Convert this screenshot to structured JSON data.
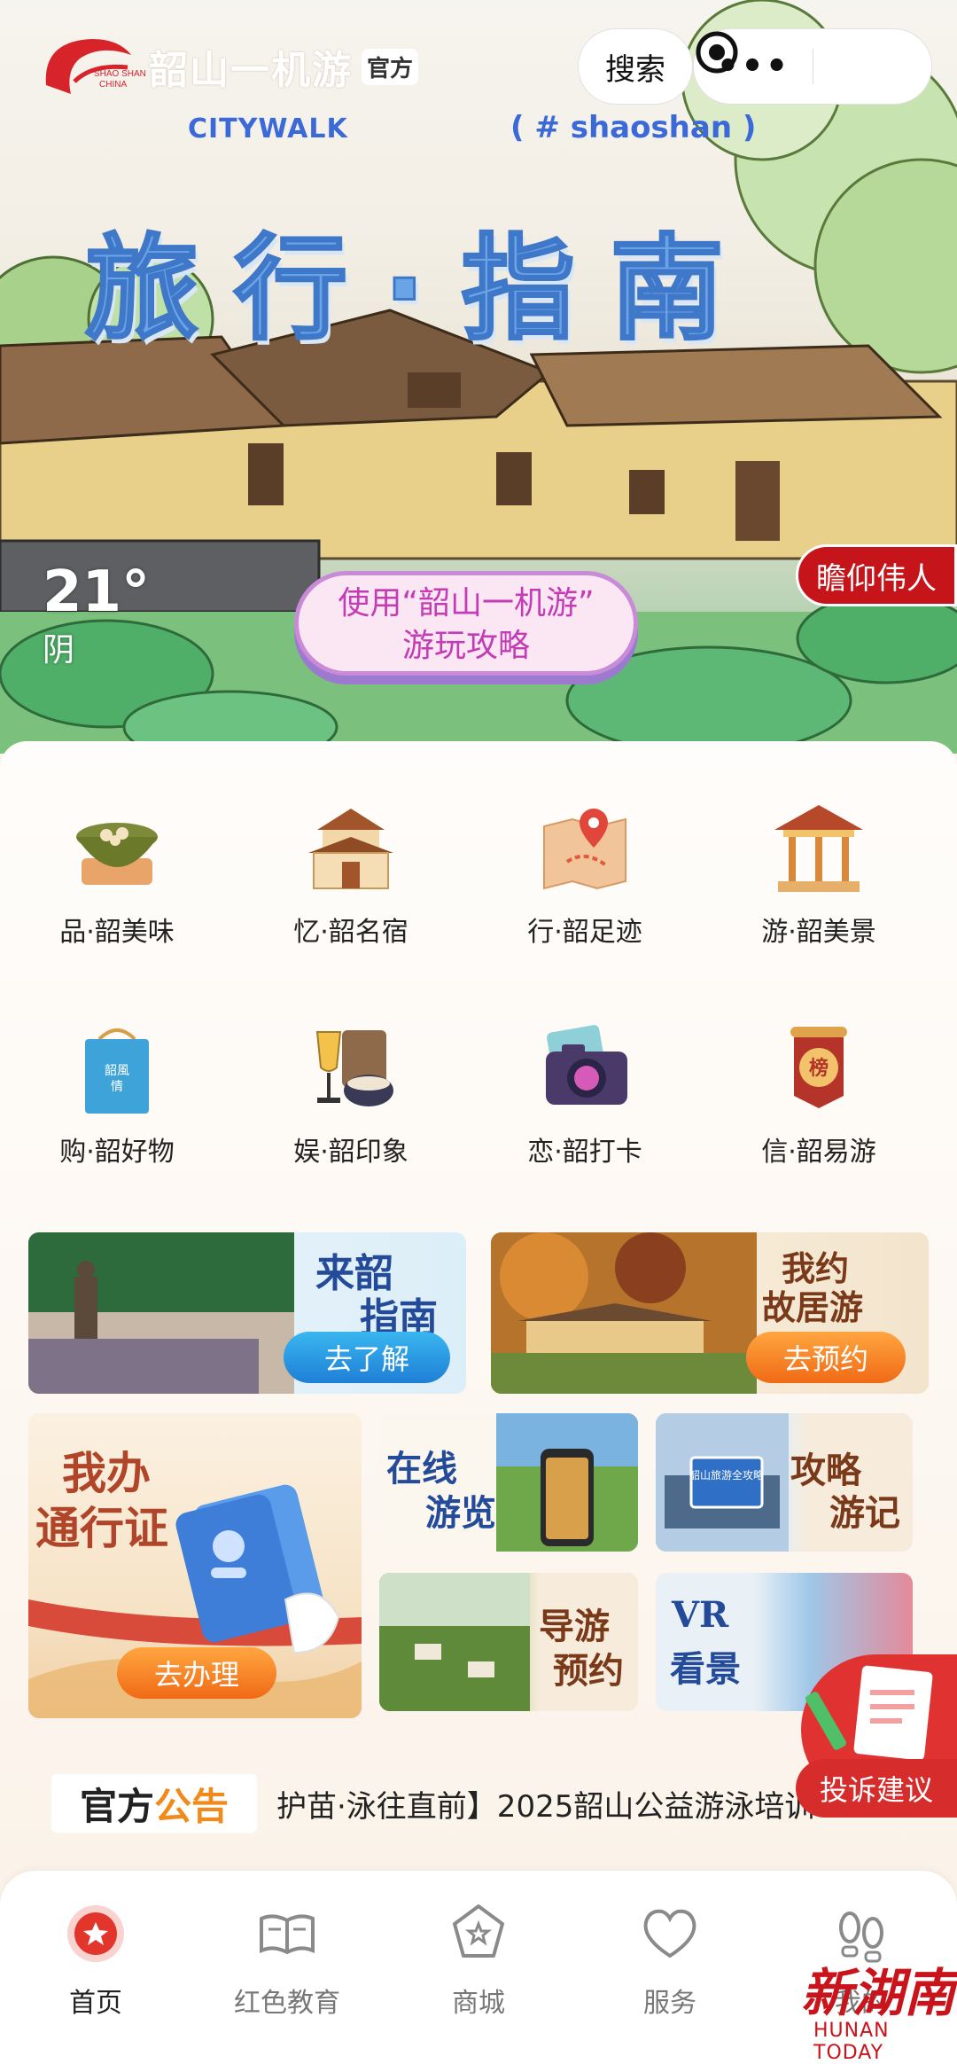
{
  "header": {
    "logo_text_1": "SHAO SHAN",
    "logo_text_2": "CHINA",
    "app_name": "韶山一机游",
    "official_tag": "官方",
    "search_label": "搜索",
    "more_label": "•••"
  },
  "hero": {
    "citywalk": "CITYWALK",
    "hashtag": "( # shaoshan )",
    "title": "旅行·指南",
    "weather": {
      "temp": "21°",
      "condition": "阴"
    },
    "promo_line1": "使用“韶山一机游”",
    "promo_line2": "游玩攻略",
    "tribute_button": "瞻仰伟人"
  },
  "services": [
    {
      "label": "品·韶美味",
      "icon": "bowl-icon"
    },
    {
      "label": "忆·韶名宿",
      "icon": "house-icon"
    },
    {
      "label": "行·韶足迹",
      "icon": "map-pin-icon"
    },
    {
      "label": "游·韶美景",
      "icon": "pavilion-icon"
    },
    {
      "label": "购·韶好物",
      "icon": "shopping-bag-icon"
    },
    {
      "label": "娱·韶印象",
      "icon": "drinks-icon"
    },
    {
      "label": "恋·韶打卡",
      "icon": "camera-icon"
    },
    {
      "label": "信·韶易游",
      "icon": "ranking-banner-icon"
    }
  ],
  "bag_text": "韶\n風\n情",
  "banner_sign_text": "榜",
  "cards": {
    "guide": {
      "title_1": "来韶",
      "title_2": "指南",
      "button": "去了解"
    },
    "residence": {
      "title_1": "我约",
      "title_2": "故居游",
      "button": "去预约"
    },
    "pass": {
      "title_1": "我办",
      "title_2": "通行证",
      "button": "去办理"
    },
    "online": {
      "title_1": "在线",
      "title_2": "游览"
    },
    "strategy": {
      "title_1": "攻略",
      "title_2": "游记",
      "sign": "韶山旅游全攻略"
    },
    "tour_guide": {
      "title_1": "导游",
      "title_2": "预约"
    },
    "vr": {
      "title_1": "VR",
      "title_2": "看景"
    }
  },
  "notice": {
    "badge_1": "官方",
    "badge_2": "公告",
    "text": "护苗·泳往直前】2025韶山公益游泳培训"
  },
  "feedback_button": "投诉建议",
  "tabs": [
    {
      "label": "首页",
      "icon": "home-star-icon",
      "active": true
    },
    {
      "label": "红色教育",
      "icon": "book-icon",
      "active": false
    },
    {
      "label": "商城",
      "icon": "shop-star-icon",
      "active": false
    },
    {
      "label": "服务",
      "icon": "heart-icon",
      "active": false
    },
    {
      "label": "我的",
      "icon": "footprints-icon",
      "active": false
    }
  ],
  "watermark": {
    "cn": "新湖南",
    "en": "HUNAN TODAY"
  },
  "colors": {
    "accent_red": "#c6151a",
    "title_blue": "#3f78c9",
    "orange_button": "#f07a1a",
    "blue_button": "#1f8fe0"
  }
}
